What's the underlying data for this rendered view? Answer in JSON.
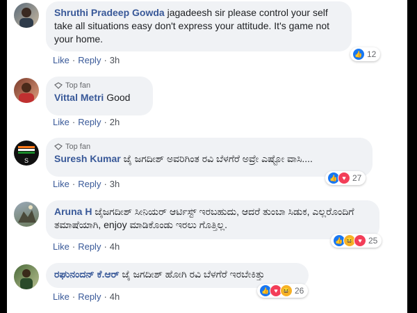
{
  "comments": [
    {
      "name": "Shruthi Pradeep Gowda",
      "text": "jagadeesh sir please control your self take all situations easy don't express your attitude. It's game not your home.",
      "top_fan": "",
      "actions": {
        "like": "Like",
        "reply": "Reply",
        "time": "3h"
      },
      "reactions": {
        "icons": [
          "like"
        ],
        "count": "12"
      }
    },
    {
      "name": "Vittal Metri",
      "text": "Good",
      "top_fan": "Top fan",
      "actions": {
        "like": "Like",
        "reply": "Reply",
        "time": "2h"
      },
      "reactions": {
        "icons": [],
        "count": ""
      }
    },
    {
      "name": "Suresh Kumar",
      "text": "ಜೈ ಜಗದೀಶ್ ಅವರಿಗಿಂತ ರವಿ ಬೆಳಗೆರೆ ಅವ್ರೇ ಎಷ್ಟೋ ವಾಸಿ....",
      "top_fan": "Top fan",
      "actions": {
        "like": "Like",
        "reply": "Reply",
        "time": "3h"
      },
      "reactions": {
        "icons": [
          "like",
          "love"
        ],
        "count": "27"
      }
    },
    {
      "name": "Aruna H",
      "text": "ಜೈಜಗದೀಶ್ ಸೀನಿಯರ್ ಆರ್ಟಿಸ್ಟ್ ಇರಬಹುದು, ಆದರೆ ತುಂಬಾ ಸಿಡುಕ, ಎಲ್ಲರೊಂದಿಗೆ ತಮಾಷೆಯಾಗಿ, enjoy ಮಾಡಿಕೊಂಡು ಇರಲು ಗೊತ್ತಿಲ್ಲ.",
      "top_fan": "",
      "actions": {
        "like": "Like",
        "reply": "Reply",
        "time": "4h"
      },
      "reactions": {
        "icons": [
          "like",
          "haha",
          "love"
        ],
        "count": "25"
      }
    },
    {
      "name": "ರಘುನಂದನ್ ಕೆ.ಆರ್",
      "text": "ಜೈ ಜಗದೀಶ್ ಹೋಗಿ ರವಿ ಬೆಳಗೆರೆ ಇರಬೇಕಿತ್ತು",
      "top_fan": "",
      "actions": {
        "like": "Like",
        "reply": "Reply",
        "time": "4h"
      },
      "reactions": {
        "icons": [
          "like",
          "love",
          "haha"
        ],
        "count": "26"
      }
    }
  ],
  "colors": {
    "name": "#385898",
    "bubble": "#f0f2f5",
    "like": "#1877f2",
    "love": "#f33e58",
    "haha": "#f7b125"
  }
}
